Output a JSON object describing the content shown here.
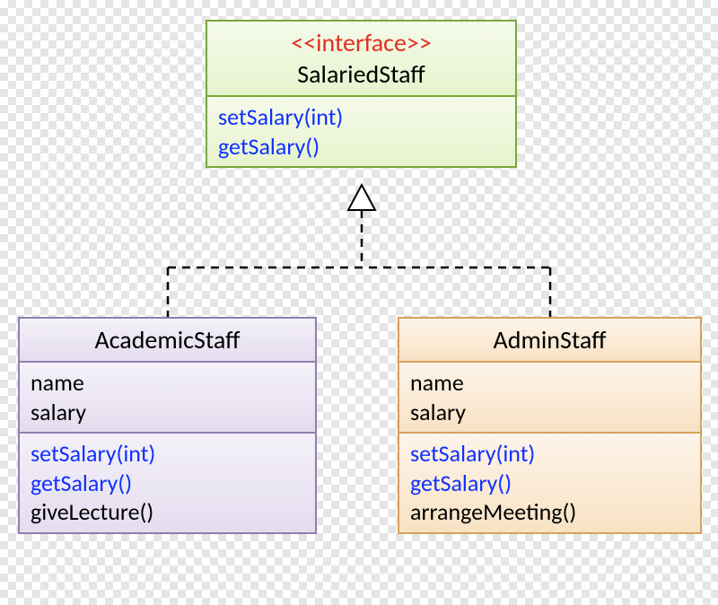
{
  "interface": {
    "stereotype": "<<interface>>",
    "name": "SalariedStaff",
    "methods": [
      "setSalary(int)",
      "getSalary()"
    ]
  },
  "academic": {
    "name": "AcademicStaff",
    "attributes": [
      "name",
      "salary"
    ],
    "methods": {
      "inherited": [
        "setSalary(int)",
        "getSalary()"
      ],
      "own": [
        "giveLecture()"
      ]
    }
  },
  "admin": {
    "name": "AdminStaff",
    "attributes": [
      "name",
      "salary"
    ],
    "methods": {
      "inherited": [
        "setSalary(int)",
        "getSalary()"
      ],
      "own": [
        "arrangeMeeting()"
      ]
    }
  },
  "colors": {
    "interface_border": "#7aa83a",
    "academic_border": "#8f7fb0",
    "admin_border": "#d6a25a",
    "stereotype": "#e03020",
    "method": "#1030ff",
    "text": "#000000"
  }
}
